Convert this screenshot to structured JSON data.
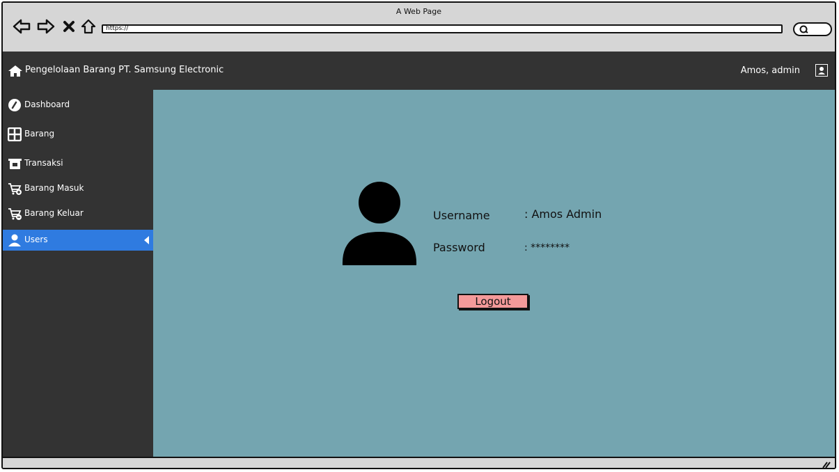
{
  "browser": {
    "title": "A Web Page",
    "url": "https://"
  },
  "header": {
    "title": "Pengelolaan Barang PT. Samsung Electronic",
    "user_label": "Amos, admin"
  },
  "sidebar": {
    "items": [
      {
        "label": "Dashboard",
        "icon": "dashboard-icon"
      },
      {
        "label": "Barang",
        "icon": "grid-icon"
      },
      {
        "label": "Transaksi",
        "icon": "register-icon"
      },
      {
        "label": "Barang Masuk",
        "icon": "cart-icon"
      },
      {
        "label": "Barang Keluar",
        "icon": "cart-icon"
      },
      {
        "label": "Users",
        "icon": "user-icon"
      }
    ],
    "active_index": 5
  },
  "profile": {
    "username_label": "Username",
    "username_value": ": Amos Admin",
    "password_label": "Password",
    "password_value": ": ********",
    "logout_label": "Logout"
  },
  "colors": {
    "header_bg": "#333333",
    "content_bg": "#74a5b0",
    "active_item": "#2f7be0",
    "logout_button": "#f49a9a"
  }
}
